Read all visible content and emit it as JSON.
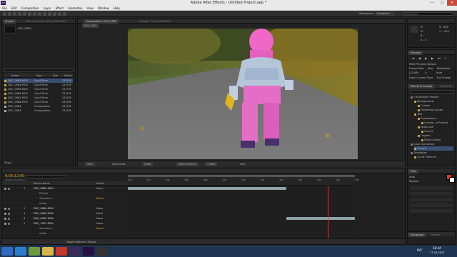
{
  "window": {
    "title": "Adobe After Effects - Untitled Project.aep *",
    "app_icon_text": "Ae",
    "minimize": "—",
    "maximize": "□",
    "close": "✕"
  },
  "menu": [
    "File",
    "Edit",
    "Composition",
    "Layer",
    "Effect",
    "Animation",
    "View",
    "Window",
    "Help"
  ],
  "toolbar": {
    "workspace_label": "Workspace:",
    "workspace_value": "Standard",
    "search_placeholder": "Search Help"
  },
  "project": {
    "tab": "Project",
    "tab2": "Effect Controls: DSC_0983.MOV",
    "selected_name": "DSC_0983",
    "search_placeholder": "",
    "columns": [
      "Name",
      "Type",
      "Size",
      "Frame Ra"
    ],
    "items": [
      {
        "name": "DSC_0983.MOV",
        "type": "QuickTime",
        "size": "...MB",
        "rate": "23,976",
        "icon": "movie",
        "color": "#c9a35a"
      },
      {
        "name": "DSC_0984.MOV",
        "type": "QuickTime",
        "size": "...MB",
        "rate": "23,976",
        "icon": "movie",
        "color": "#c9a35a"
      },
      {
        "name": "DSC_0985.MOV",
        "type": "QuickTime",
        "size": "...MB",
        "rate": "23,976",
        "icon": "movie",
        "color": "#c9a35a"
      },
      {
        "name": "DSC_0986.MOV",
        "type": "QuickTime",
        "size": "...MB",
        "rate": "23,976",
        "icon": "movie",
        "color": "#c9a35a"
      },
      {
        "name": "DSC_0987.MOV",
        "type": "QuickTime",
        "size": "...MB",
        "rate": "23,976",
        "icon": "movie",
        "color": "#c9a35a"
      },
      {
        "name": "DSC_0988.MOV",
        "type": "QuickTime",
        "size": "...MB",
        "rate": "23,976",
        "icon": "movie",
        "color": "#c9a35a"
      },
      {
        "name": "DSC_0983",
        "type": "Composition",
        "size": "",
        "rate": "23,976",
        "icon": "comp",
        "color": "#a9a9a9"
      },
      {
        "name": "DSC_0984",
        "type": "Composition",
        "size": "",
        "rate": "23,976",
        "icon": "comp",
        "color": "#a9a9a9"
      }
    ],
    "footer_bpc": "8 bpc"
  },
  "composition": {
    "tab": "Composition: DSC_0983",
    "tab_footage": "Footage: DSC_0983.MOV",
    "sub_tab": "DSC_0983",
    "zoom": "50%",
    "timecode": "0;00;12;00",
    "resolution": "(Half)",
    "camera": "Active Camera",
    "views": "1 View",
    "exposure": "+0,0"
  },
  "info": {
    "r": "R :",
    "g": "G :",
    "b": "B :",
    "a": "A : 0",
    "x": "X : 458",
    "y": "Y : -214"
  },
  "preview": {
    "tab": "Preview",
    "ram_options": "RAM Preview Options",
    "frame_rate_label": "Frame Rate",
    "skip_label": "Skip",
    "resolution_label": "Resolution",
    "frame_rate": "(23,98)",
    "skip": "0",
    "resolution": "Auto",
    "from_current": "From Current Time",
    "full_screen": "Full Screen"
  },
  "effects": {
    "tab": "Effects & Presets",
    "tab2": "Character",
    "search": "",
    "tree": [
      {
        "label": "* Animation Presets",
        "depth": 0
      },
      {
        "label": "Backgrounds",
        "depth": 1
      },
      {
        "label": "Curtain",
        "depth": 2
      },
      {
        "label": "Flickering Curtain",
        "depth": 2
      },
      {
        "label": "Text",
        "depth": 1
      },
      {
        "label": "Expressions",
        "depth": 2
      },
      {
        "label": "Current...e Format",
        "depth": 3
      },
      {
        "label": "Multi-Line",
        "depth": 2
      },
      {
        "label": "Comet",
        "depth": 3
      },
      {
        "label": "Organic",
        "depth": 2
      },
      {
        "label": "Wind Cursed",
        "depth": 3
      },
      {
        "label": "Color Correction",
        "depth": 0
      },
      {
        "label": "Curves",
        "depth": 1
      },
      {
        "label": "Simulation",
        "depth": 0
      },
      {
        "label": "CC Mr. Mercury",
        "depth": 1
      }
    ]
  },
  "character": {
    "tab": "Font",
    "font": "Arial",
    "style": "Regular",
    "fill_color": "#e8331c",
    "stroke_color": "#ffffff"
  },
  "timeline": {
    "timecode": "0;00;12;00",
    "fps_note": "00288 (23.976 fps)",
    "search_placeholder": "",
    "col_source": "Source Name",
    "col_parent": "Parent",
    "ruler": [
      "00s",
      "02s",
      "04s",
      "06s",
      "08s",
      "10s",
      "12s",
      "14s",
      "16s",
      "18s",
      "20s",
      "22s",
      "24s"
    ],
    "layers": [
      {
        "num": "1",
        "name": "DSC_0985.MOV",
        "parent": "None"
      },
      {
        "num": "",
        "name": "Effects",
        "parent": ""
      },
      {
        "num": "",
        "name": "Transform",
        "parent": "Reset"
      },
      {
        "num": "",
        "name": "Audio",
        "parent": ""
      },
      {
        "num": "2",
        "name": "DSC_0984.MOV",
        "parent": "None"
      },
      {
        "num": "3",
        "name": "DSC_0983.MOV",
        "parent": "None"
      },
      {
        "num": "4",
        "name": "DSC_0982.MOV",
        "parent": "None"
      },
      {
        "num": "5",
        "name": "DSC_1001.MOV",
        "parent": "None"
      },
      {
        "num": "",
        "name": "Transform",
        "parent": "Reset"
      },
      {
        "num": "",
        "name": "Audio",
        "parent": ""
      }
    ],
    "footer_toggle": "Toggle Switches / Modes"
  },
  "paragraph": {
    "tab": "Paragraph",
    "tab2": "Motion"
  },
  "tray": {
    "lang": "РУС",
    "time": "18:44",
    "date": "17.10.2017"
  },
  "colors": {
    "accent": "#3a4f74",
    "clip_bar": "#8ea3a6",
    "playhead": "#c8402a",
    "work_area": "#6b6b6b"
  }
}
